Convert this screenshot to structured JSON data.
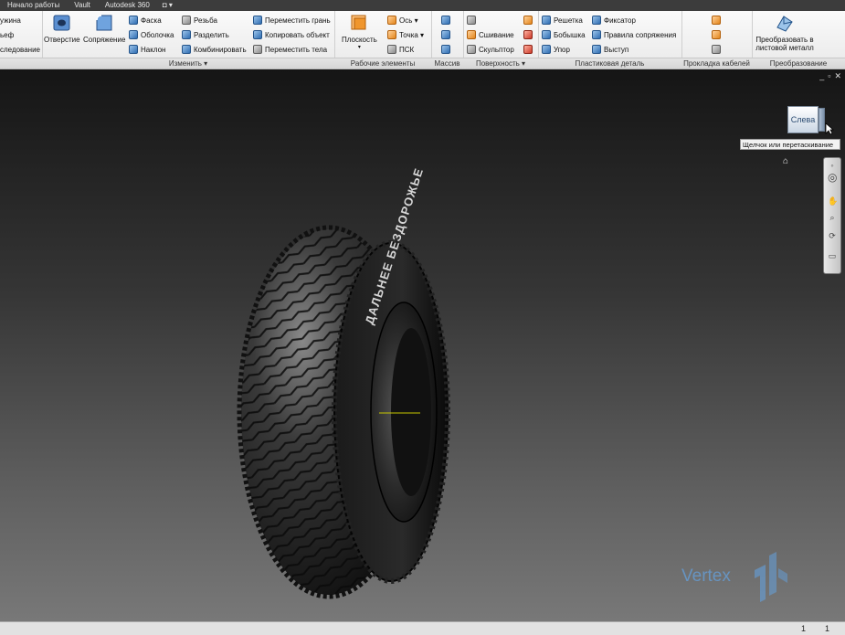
{
  "tabs": [
    "Начало работы",
    "Vault",
    "Autodesk 360",
    "◘ ▾"
  ],
  "ribbon": {
    "left_partial": [
      "ужина",
      "ьеф",
      "следование"
    ],
    "modify": {
      "hole": "Отверстие",
      "fillet": "Сопряжение",
      "chamfer": "Фаска",
      "shell": "Оболочка",
      "draft": "Наклон",
      "thread": "Резьба",
      "split": "Разделить",
      "combine": "Комбинировать",
      "move_face": "Переместить грань",
      "copy_object": "Копировать объект",
      "move_bodies": "Переместить тела",
      "title": "Изменить ▾"
    },
    "work_features": {
      "plane": "Плоскость",
      "plane_arrow": "▾",
      "axis": "Ось ▾",
      "point": "Точка ▾",
      "ucs": "ПСК",
      "title": "Рабочие элементы"
    },
    "pattern": {
      "title": "Массив"
    },
    "surface": {
      "stitch": "Сшивание",
      "sculpt": "Скульптор",
      "title": "Поверхность ▾"
    },
    "plastic_part": {
      "grill": "Решетка",
      "boss": "Бобышка",
      "rest": "Упор",
      "snap_fit": "Фиксатор",
      "rule_fillet": "Правила сопряжения",
      "lip": "Выступ",
      "title": "Пластиковая деталь"
    },
    "cable": {
      "title": "Прокладка кабелей"
    },
    "convert": {
      "label_line1": "Преобразовать в",
      "label_line2": "листовой металл",
      "title": "Преобразование"
    }
  },
  "viewport": {
    "window_controls": [
      "_",
      "▫",
      "✕"
    ],
    "viewcube_face": "Слева",
    "viewcube_tooltip": "Щелчок или перетаскивание",
    "watermark": "Vertex",
    "tire_sidewall_text": "ДАЛЬНЕЕ БЕЗДОРОЖЬЕ"
  },
  "status": {
    "left": "1",
    "right": "1"
  },
  "colors": {
    "ribbon_bg": "#f0f0f0",
    "tab_bar": "#3c3c3c",
    "viewport_top": "#151515",
    "viewport_bottom": "#787878",
    "accent_blue": "#2f6db2",
    "watermark": "#64a0dc",
    "axis_line": "#c8c800"
  }
}
